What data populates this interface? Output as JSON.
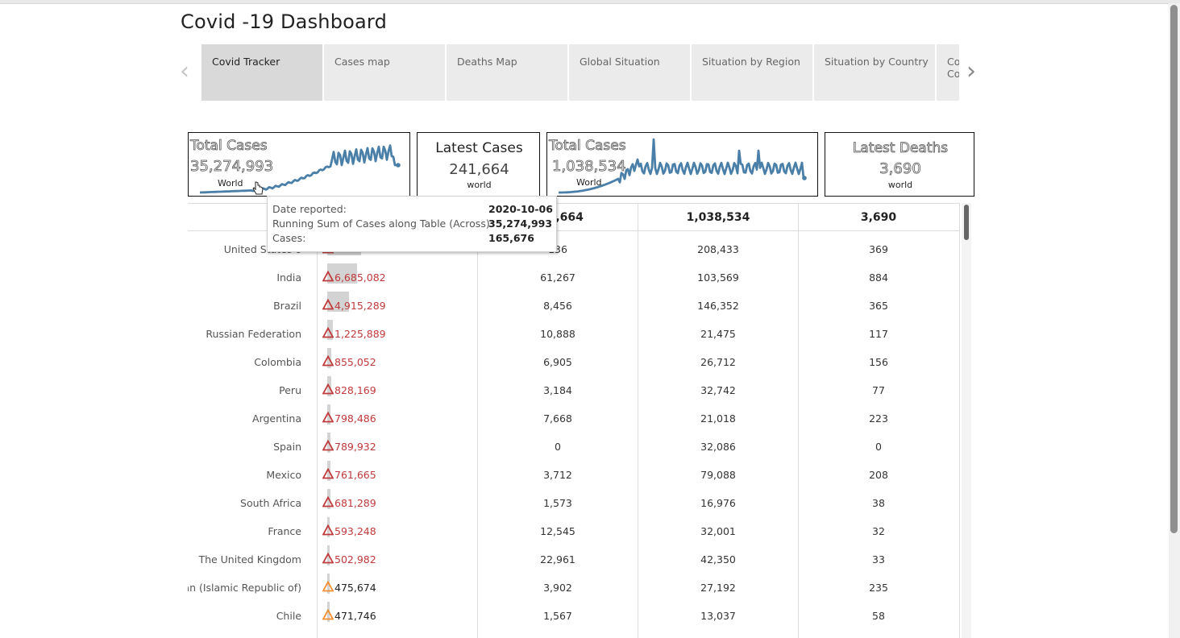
{
  "title": "Covid -19 Dashboard",
  "tabs": [
    {
      "label": "Covid Tracker",
      "active": true
    },
    {
      "label": "Cases map"
    },
    {
      "label": "Deaths Map"
    },
    {
      "label": "Global Situation"
    },
    {
      "label": "Situation by Region"
    },
    {
      "label": "Situation by Country"
    },
    {
      "label": "Co\nCo"
    }
  ],
  "nav": {
    "prev_icon": "chevron-left-icon",
    "next_icon": "chevron-right-icon"
  },
  "kpis": {
    "total_cases": {
      "label": "Total Cases",
      "value": "35,274,993",
      "scope": "World"
    },
    "latest_cases": {
      "label": "Latest Cases",
      "value": "241,664",
      "scope": "world"
    },
    "total_deaths": {
      "label": "Total Cases",
      "value": "1,038,534",
      "scope": "World"
    },
    "latest_deaths": {
      "label": "Latest Deaths",
      "value": "3,690",
      "scope": "world"
    }
  },
  "colors": {
    "line": "#4a7fa7",
    "up_red": "#c0393b",
    "up_orange": "#f28e2b",
    "bar": "#d3d3d3"
  },
  "table": {
    "headers": [
      "",
      "",
      "241,664",
      "1,038,534",
      "3,690"
    ],
    "rows": [
      {
        "country": "United States o",
        "total": "",
        "latest": "136",
        "deaths": "208,433",
        "latest_deaths": "369",
        "trend": "red",
        "bar": 0.2
      },
      {
        "country": "India",
        "total": "6,685,082",
        "latest": "61,267",
        "deaths": "103,569",
        "latest_deaths": "884",
        "trend": "red",
        "bar": 0.176
      },
      {
        "country": "Brazil",
        "total": "4,915,289",
        "latest": "8,456",
        "deaths": "146,352",
        "latest_deaths": "365",
        "trend": "red",
        "bar": 0.13
      },
      {
        "country": "Russian Federation",
        "total": "1,225,889",
        "latest": "10,888",
        "deaths": "21,475",
        "latest_deaths": "117",
        "trend": "red",
        "bar": 0.032
      },
      {
        "country": "Colombia",
        "total": "855,052",
        "latest": "6,905",
        "deaths": "26,712",
        "latest_deaths": "156",
        "trend": "red",
        "bar": 0.022
      },
      {
        "country": "Peru",
        "total": "828,169",
        "latest": "3,184",
        "deaths": "32,742",
        "latest_deaths": "77",
        "trend": "red",
        "bar": 0.022
      },
      {
        "country": "Argentina",
        "total": "798,486",
        "latest": "7,668",
        "deaths": "21,018",
        "latest_deaths": "223",
        "trend": "red",
        "bar": 0.021
      },
      {
        "country": "Spain",
        "total": "789,932",
        "latest": "0",
        "deaths": "32,086",
        "latest_deaths": "0",
        "trend": "red",
        "bar": 0.021
      },
      {
        "country": "Mexico",
        "total": "761,665",
        "latest": "3,712",
        "deaths": "79,088",
        "latest_deaths": "208",
        "trend": "red",
        "bar": 0.02
      },
      {
        "country": "South Africa",
        "total": "681,289",
        "latest": "1,573",
        "deaths": "16,976",
        "latest_deaths": "38",
        "trend": "red",
        "bar": 0.018
      },
      {
        "country": "France",
        "total": "593,248",
        "latest": "12,545",
        "deaths": "32,001",
        "latest_deaths": "32",
        "trend": "red",
        "bar": 0.016
      },
      {
        "country": "The United Kingdom",
        "total": "502,982",
        "latest": "22,961",
        "deaths": "42,350",
        "latest_deaths": "33",
        "trend": "red",
        "bar": 0.013
      },
      {
        "country": "Iran (Islamic Republic of)",
        "total": "475,674",
        "latest": "3,902",
        "deaths": "27,192",
        "latest_deaths": "235",
        "trend": "orange",
        "bar": 0.012
      },
      {
        "country": "Chile",
        "total": "471,746",
        "latest": "1,567",
        "deaths": "13,037",
        "latest_deaths": "58",
        "trend": "orange",
        "bar": 0.012
      }
    ]
  },
  "tooltip": {
    "rows": [
      {
        "key": "Date reported:",
        "value": "2020-10-06"
      },
      {
        "key": "Running Sum of Cases along Table (Across):",
        "value": "35,274,993"
      },
      {
        "key": "Cases:",
        "value": "165,676"
      }
    ]
  }
}
